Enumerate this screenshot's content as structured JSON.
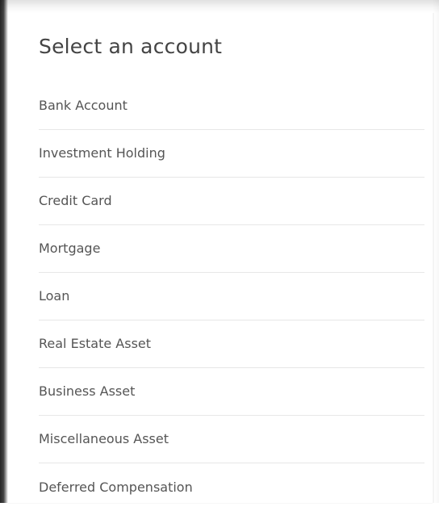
{
  "dialog": {
    "title": "Select an account"
  },
  "accounts": [
    {
      "label": "Bank Account"
    },
    {
      "label": "Investment Holding"
    },
    {
      "label": "Credit Card"
    },
    {
      "label": "Mortgage"
    },
    {
      "label": "Loan"
    },
    {
      "label": "Real Estate Asset"
    },
    {
      "label": "Business Asset"
    },
    {
      "label": "Miscellaneous Asset"
    },
    {
      "label": "Deferred Compensation"
    }
  ]
}
